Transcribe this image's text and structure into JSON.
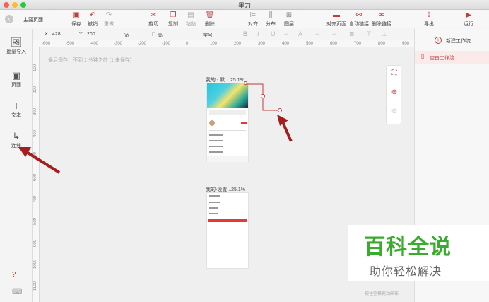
{
  "window": {
    "title": "墨刀"
  },
  "toolbar": {
    "page_name": "主要页面",
    "buttons": [
      {
        "label": "保存",
        "icon": "save-icon",
        "glyph": "▣"
      },
      {
        "label": "撤销",
        "icon": "undo-icon",
        "glyph": "↶"
      },
      {
        "label": "重做",
        "icon": "redo-icon",
        "glyph": "↷"
      },
      {
        "label": "剪切",
        "icon": "cut-icon",
        "glyph": "✂"
      },
      {
        "label": "复制",
        "icon": "copy-icon",
        "glyph": "❐"
      },
      {
        "label": "粘贴",
        "icon": "paste-icon",
        "glyph": "▤"
      },
      {
        "label": "删除",
        "icon": "trash-icon",
        "glyph": "🗑"
      },
      {
        "label": "对齐",
        "icon": "align-icon",
        "glyph": "⊫"
      },
      {
        "label": "分布",
        "icon": "distribute-icon",
        "glyph": "⫼"
      },
      {
        "label": "图层",
        "icon": "layers-icon",
        "glyph": "⊞"
      },
      {
        "label": "对齐页面",
        "icon": "align-page-icon",
        "glyph": "▬"
      },
      {
        "label": "自动链接",
        "icon": "auto-link-icon",
        "glyph": "⚯"
      },
      {
        "label": "删除链接",
        "icon": "unlink-icon",
        "glyph": "⚮"
      },
      {
        "label": "导出",
        "icon": "export-icon",
        "glyph": "⇪"
      },
      {
        "label": "运行",
        "icon": "run-icon",
        "glyph": "▶"
      }
    ]
  },
  "props": {
    "x_label": "X",
    "x_value": "428",
    "y_label": "Y",
    "y_value": "200",
    "width_label": "宽",
    "height_label": "高",
    "font_label": "字号"
  },
  "left_panel": [
    {
      "label": "批量导入",
      "icon": "image-import-icon",
      "glyph": "🖼"
    },
    {
      "label": "页面",
      "icon": "page-icon",
      "glyph": "▣"
    },
    {
      "label": "文本",
      "icon": "text-icon",
      "glyph": "T"
    },
    {
      "label": "连线",
      "icon": "connector-icon",
      "glyph": "↳"
    }
  ],
  "left_bottom": {
    "help_icon": "help-icon",
    "help_glyph": "?",
    "keyboard_icon": "keyboard-icon",
    "keyboard_glyph": "⌨"
  },
  "rulers": {
    "h": [
      "-600",
      "-500",
      "-400",
      "-300",
      "-200",
      "-100",
      "0",
      "100",
      "200",
      "300",
      "400",
      "500",
      "600",
      "700",
      "800",
      "900",
      "1000",
      "1100"
    ],
    "v": [
      "100",
      "200",
      "300",
      "400",
      "500",
      "600",
      "700",
      "800",
      "900",
      "1000",
      "1100"
    ]
  },
  "canvas": {
    "saved_text": "最后保存：不到 1 分钟之前 (1 未保存)",
    "artboards": [
      {
        "label": "我的 - 默...  25.1%"
      },
      {
        "label": "我的-设置...25.1%"
      }
    ],
    "hint": "按住空格拖动画布",
    "accent": "#c23b3b"
  },
  "right_panel": {
    "new_flow_label": "新建工作流",
    "flows": [
      {
        "label": "空白工作流"
      }
    ]
  },
  "watermark": {
    "title": "百科全说",
    "subtitle": "助你轻松解决"
  }
}
